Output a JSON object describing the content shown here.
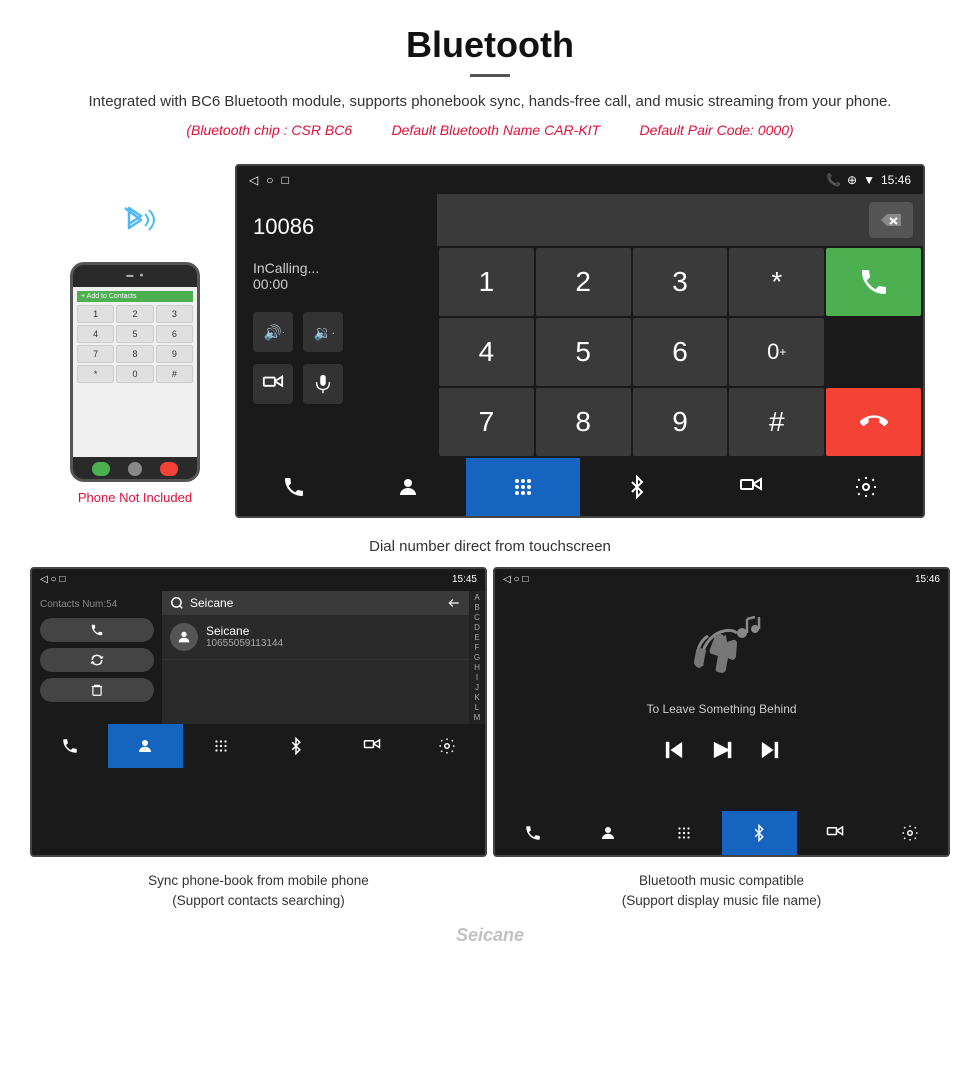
{
  "header": {
    "title": "Bluetooth",
    "description": "Integrated with BC6 Bluetooth module, supports phonebook sync, hands-free call, and music streaming from your phone.",
    "spec_chip": "(Bluetooth chip : CSR BC6",
    "spec_name": "Default Bluetooth Name CAR-KIT",
    "spec_code": "Default Pair Code: 0000)",
    "phone_label": "Phone Not Included"
  },
  "large_screen": {
    "status_bar": {
      "time": "15:46",
      "icons_left": [
        "◁",
        "○",
        "□"
      ],
      "icons_right": [
        "📞",
        "⊕",
        "▼"
      ]
    },
    "dialer": {
      "number": "10086",
      "status": "InCalling...",
      "timer": "00:00"
    },
    "numpad": {
      "keys": [
        "1",
        "2",
        "3",
        "*",
        "4",
        "5",
        "6",
        "0+",
        "7",
        "8",
        "9",
        "#"
      ]
    },
    "caption": "Dial number direct from touchscreen"
  },
  "contacts_screen": {
    "status_time": "15:45",
    "contacts_count": "Contacts Num:54",
    "search_placeholder": "Seicane",
    "contact_name": "Seicane",
    "contact_phone": "10655059113144",
    "alpha_list": [
      "A",
      "B",
      "C",
      "D",
      "E",
      "F",
      "G",
      "H",
      "I",
      "J",
      "K",
      "L",
      "M"
    ],
    "caption": "Sync phone-book from mobile phone\n(Support contacts searching)"
  },
  "music_screen": {
    "status_time": "15:46",
    "song_title": "To Leave Something Behind",
    "caption": "Bluetooth music compatible\n(Support display music file name)"
  },
  "watermark": "Seicane"
}
